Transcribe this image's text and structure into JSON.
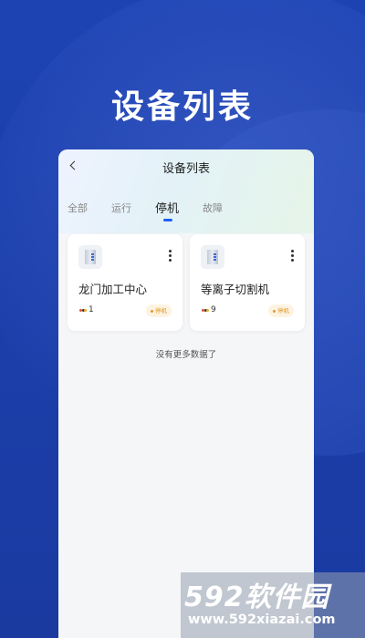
{
  "hero": {
    "title": "设备列表"
  },
  "header": {
    "title": "设备列表",
    "back_icon": "chevron-left-icon"
  },
  "tabs": [
    {
      "label": "全部",
      "active": false
    },
    {
      "label": "运行",
      "active": false
    },
    {
      "label": "停机",
      "active": true
    },
    {
      "label": "故障",
      "active": false
    }
  ],
  "devices": [
    {
      "name": "龙门加工中心",
      "count": "1",
      "status": "停机"
    },
    {
      "name": "等离子切割机",
      "count": "9",
      "status": "停机"
    }
  ],
  "footer_text": "没有更多数据了",
  "watermark": {
    "logo_num": "592",
    "logo_text": "软件园",
    "url": "www.592xiazai.com"
  },
  "colors": {
    "accent": "#1d5ff5",
    "status_stopped": "#e09a2a",
    "background": "#1a3fa8"
  }
}
